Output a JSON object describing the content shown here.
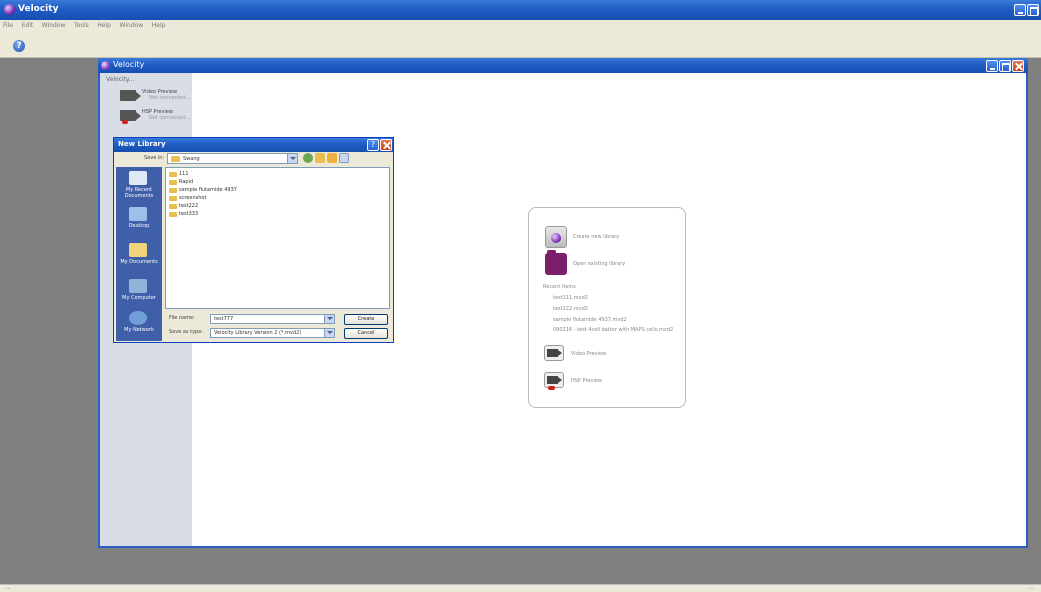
{
  "app": {
    "title": "Velocity",
    "menu": [
      "File",
      "Edit",
      "Window",
      "Tools",
      "Help",
      "Window",
      "Help"
    ],
    "status_left": "...",
    "status_right": "..."
  },
  "velocity_window": {
    "title": "Velocity"
  },
  "sidebar": {
    "header": "Velocity...",
    "items": [
      {
        "label": "Video Preview",
        "sub": "Not connected..."
      },
      {
        "label": "HSP Preview",
        "sub": "Not connected..."
      }
    ]
  },
  "start_card": {
    "new_library": "Create new library",
    "open_library": "Open existing library",
    "recent_label": "Recent Items",
    "recent_items": [
      "test111.mvd2",
      "test222.mvd2",
      "sample flutamide 4937.mvd2",
      "090216 - test 4cell batter with MAPS cells.mvd2"
    ],
    "video_preview": "Video Preview",
    "hsp_preview": "HSP Preview"
  },
  "dialog": {
    "title": "New Library",
    "save_in_label": "Save in:",
    "save_in_value": "Swang",
    "places": [
      "My Recent Documents",
      "Desktop",
      "My Documents",
      "My Computer",
      "My Network"
    ],
    "files": [
      "111",
      "Rapid",
      "sample flutamide 4937",
      "screenshot",
      "test222",
      "test333"
    ],
    "file_name_label": "File name:",
    "file_name_value": "test777",
    "save_type_label": "Save as type:",
    "save_type_value": "Velocity Library Version 2 (*.mvd2)",
    "create_label": "Create",
    "cancel_label": "Cancel"
  }
}
